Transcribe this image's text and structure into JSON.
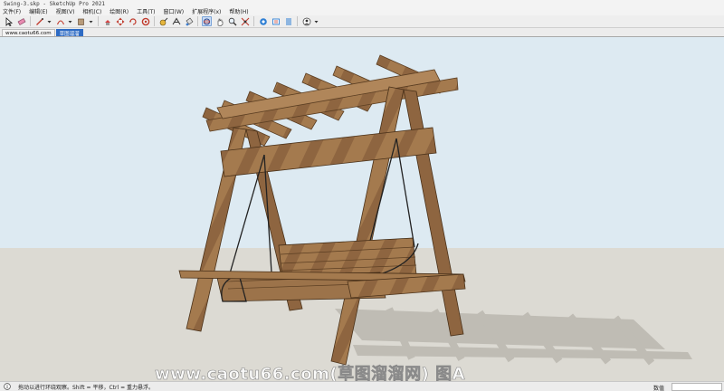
{
  "window": {
    "title": "Swing-3.skp - SketchUp Pro 2021"
  },
  "menu": [
    "文件(F)",
    "编辑(E)",
    "视图(V)",
    "相机(C)",
    "绘图(R)",
    "工具(T)",
    "窗口(W)",
    "扩展程序(x)",
    "帮助(H)"
  ],
  "toolbar": {
    "icons": [
      "select-icon",
      "eraser-icon",
      "line-icon",
      "arc-icon",
      "rectangle-icon",
      "push-pull-icon",
      "move-icon",
      "rotate-icon",
      "scale-icon",
      "offset-icon",
      "tape-measure-icon",
      "text-icon",
      "paint-bucket-icon",
      "orbit-icon",
      "pan-icon",
      "zoom-icon",
      "zoom-extents-icon",
      "warehouse-icon",
      "extension-warehouse-icon",
      "layout-icon",
      "account-icon"
    ],
    "active_tool": "orbit-icon"
  },
  "tabs": [
    {
      "label": "www.caotu66.com",
      "active": false
    },
    {
      "label": "草图溜溜",
      "active": true
    }
  ],
  "watermark": "www.caotu66.com(草图溜溜网) 图A",
  "status": {
    "message": "拖动以进行环绕观察。Shift = 平移，Ctrl = 重力悬浮。",
    "measurements_label": "数值",
    "measurements_value": ""
  },
  "colors": {
    "sky": "#ddeaf2",
    "ground": "#dcdad3",
    "wood": "#a3794d",
    "wood_dark": "#6b4a2a",
    "shadow": "#b9b6ae",
    "tab_active": "#2d6bc4"
  }
}
